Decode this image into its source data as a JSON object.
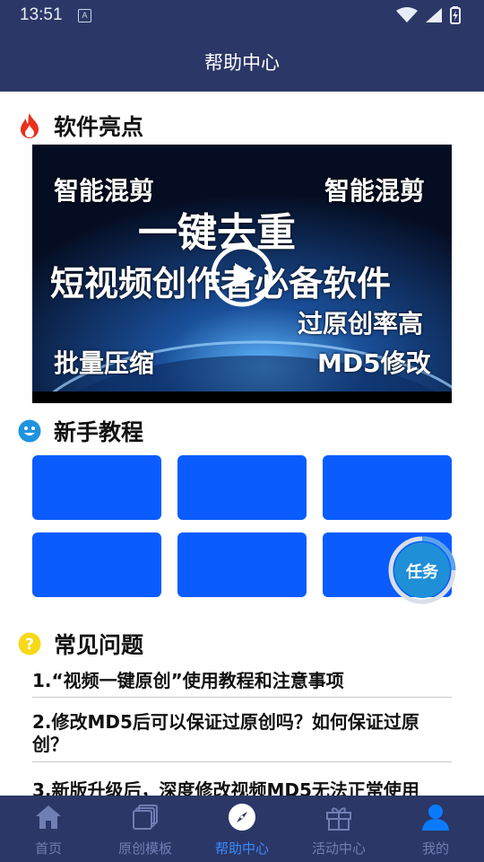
{
  "status_bar": {
    "time": "13:51",
    "notification_badge": "A"
  },
  "header": {
    "title": "帮助中心"
  },
  "highlights": {
    "heading": "软件亮点",
    "icon": "fire-icon",
    "video": {
      "text_top_left": "智能混剪",
      "text_top_right": "智能混剪",
      "headline": "一键去重",
      "subline": "短视频创作者必备软件",
      "text_mid_right": "过原创率高",
      "text_bottom_left": "批量压缩",
      "text_bottom_right": "MD5修改"
    }
  },
  "tutorials": {
    "heading": "新手教程",
    "icon": "smiley-icon",
    "tile_color": "#0a5cff",
    "tile_count": 6
  },
  "task_button": {
    "label": "任务"
  },
  "faq": {
    "heading": "常见问题",
    "icon": "question-icon",
    "items": [
      {
        "text": "1.“视频一键原创”使用教程和注意事项"
      },
      {
        "text": "2.修改MD5后可以保证过原创吗？如何保证过原创？"
      },
      {
        "text": "3.新版升级后，深度修改视频MD5无法正常使用"
      }
    ]
  },
  "tabbar": {
    "items": [
      {
        "label": "首页",
        "icon": "home-icon",
        "active": false
      },
      {
        "label": "原创模板",
        "icon": "template-icon",
        "active": false
      },
      {
        "label": "帮助中心",
        "icon": "compass-icon",
        "active": true
      },
      {
        "label": "活动中心",
        "icon": "gift-icon",
        "active": false
      },
      {
        "label": "我的",
        "icon": "user-icon",
        "active": false
      }
    ]
  },
  "colors": {
    "header_bg": "#2b3766",
    "accent": "#0a5cff",
    "active_tab": "#3b8bff",
    "inactive_tab": "#6f7fb4"
  }
}
